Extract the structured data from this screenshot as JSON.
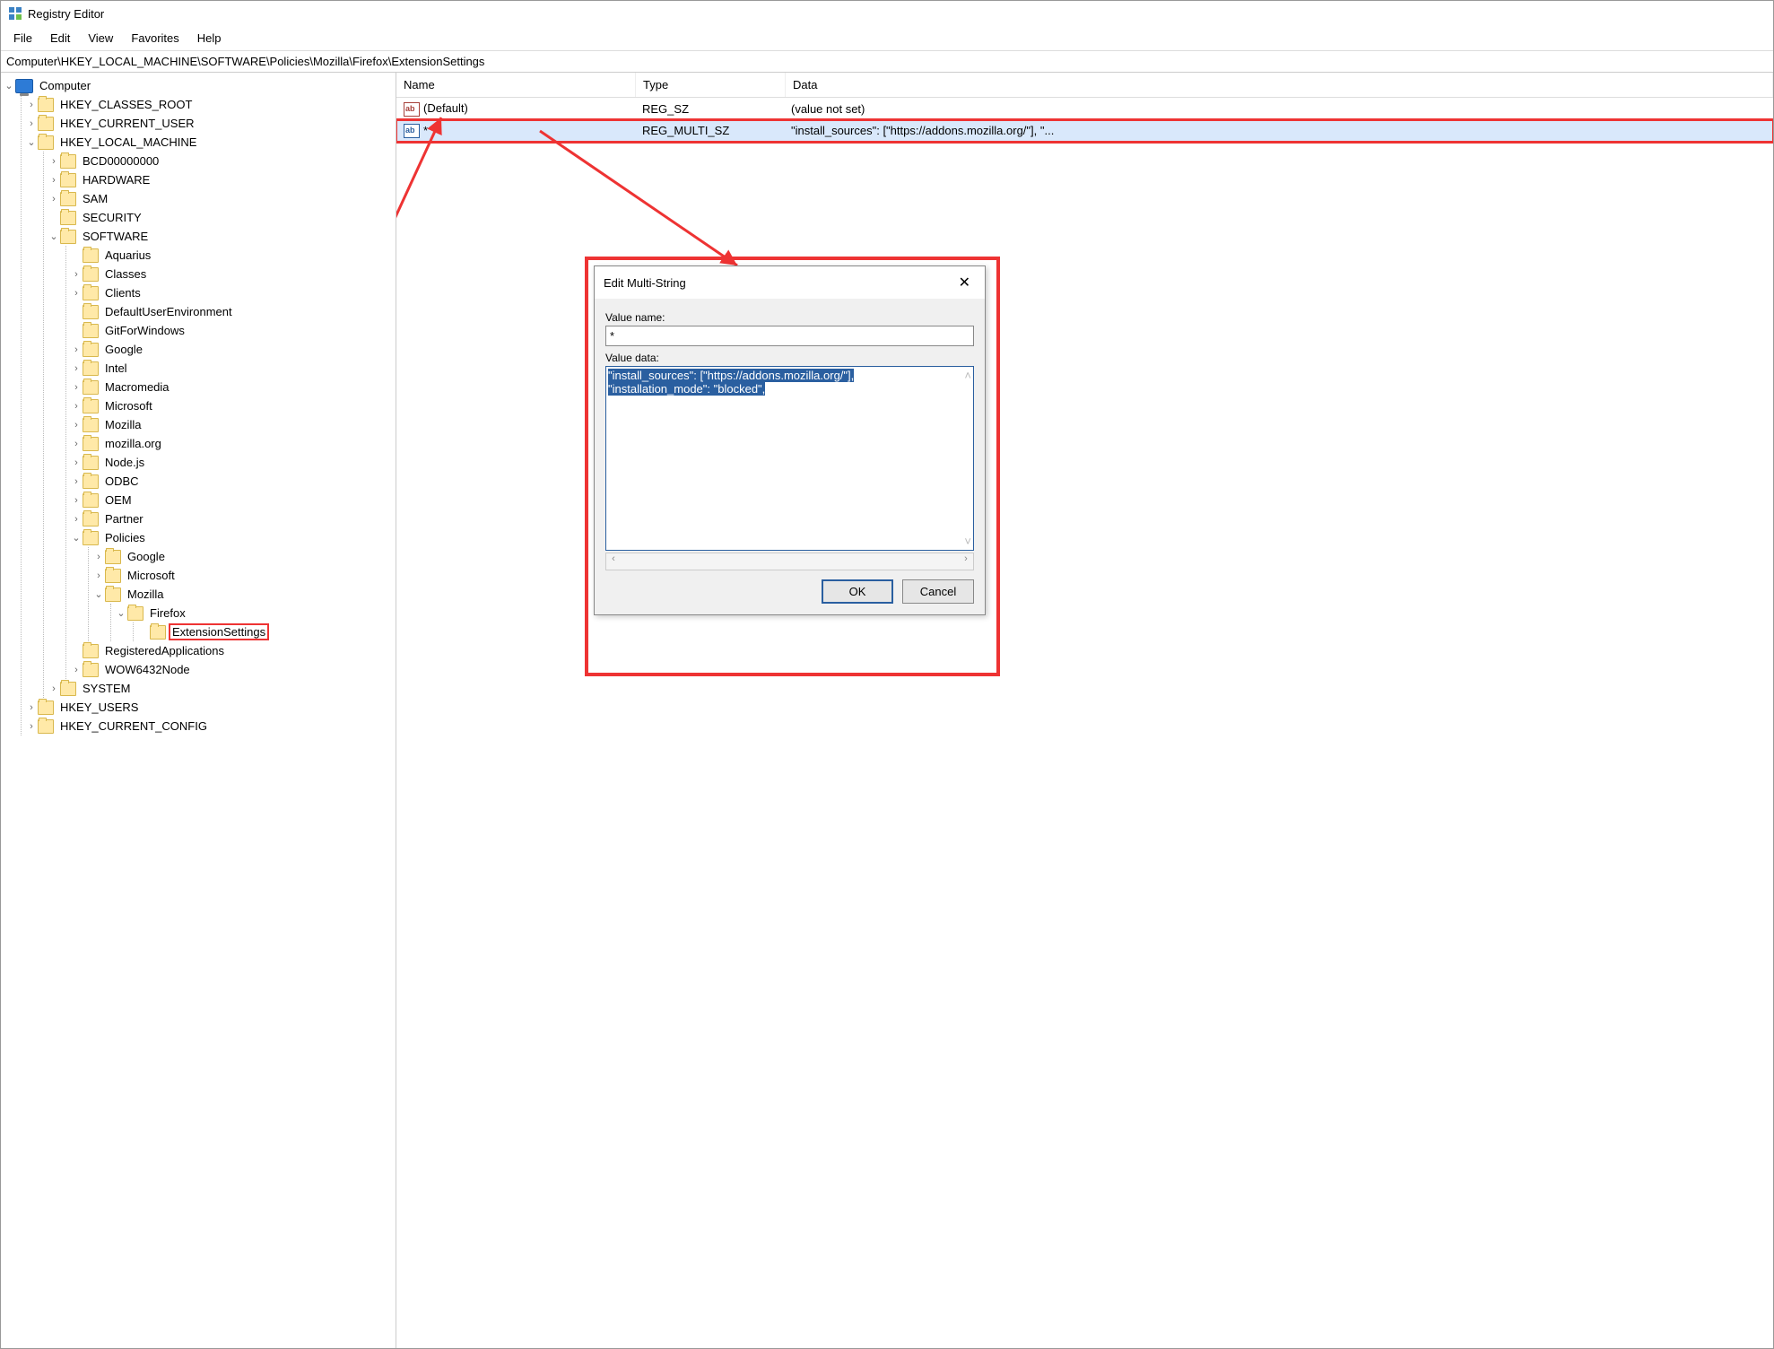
{
  "title": "Registry Editor",
  "menubar": [
    "File",
    "Edit",
    "View",
    "Favorites",
    "Help"
  ],
  "address": "Computer\\HKEY_LOCAL_MACHINE\\SOFTWARE\\Policies\\Mozilla\\Firefox\\ExtensionSettings",
  "tree": {
    "root": "Computer",
    "hives": [
      {
        "name": "HKEY_CLASSES_ROOT",
        "expand": ">"
      },
      {
        "name": "HKEY_CURRENT_USER",
        "expand": ">"
      },
      {
        "name": "HKEY_LOCAL_MACHINE",
        "expand": "v",
        "children": [
          {
            "name": "BCD00000000",
            "expand": ">"
          },
          {
            "name": "HARDWARE",
            "expand": ">"
          },
          {
            "name": "SAM",
            "expand": ">"
          },
          {
            "name": "SECURITY",
            "expand": ""
          },
          {
            "name": "SOFTWARE",
            "expand": "v",
            "children": [
              {
                "name": "Aquarius",
                "expand": ""
              },
              {
                "name": "Classes",
                "expand": ">"
              },
              {
                "name": "Clients",
                "expand": ">"
              },
              {
                "name": "DefaultUserEnvironment",
                "expand": ""
              },
              {
                "name": "GitForWindows",
                "expand": ""
              },
              {
                "name": "Google",
                "expand": ">"
              },
              {
                "name": "Intel",
                "expand": ">"
              },
              {
                "name": "Macromedia",
                "expand": ">"
              },
              {
                "name": "Microsoft",
                "expand": ">"
              },
              {
                "name": "Mozilla",
                "expand": ">"
              },
              {
                "name": "mozilla.org",
                "expand": ">"
              },
              {
                "name": "Node.js",
                "expand": ">"
              },
              {
                "name": "ODBC",
                "expand": ">"
              },
              {
                "name": "OEM",
                "expand": ">"
              },
              {
                "name": "Partner",
                "expand": ">"
              },
              {
                "name": "Policies",
                "expand": "v",
                "children": [
                  {
                    "name": "Google",
                    "expand": ">"
                  },
                  {
                    "name": "Microsoft",
                    "expand": ">"
                  },
                  {
                    "name": "Mozilla",
                    "expand": "v",
                    "children": [
                      {
                        "name": "Firefox",
                        "expand": "v",
                        "children": [
                          {
                            "name": "ExtensionSettings",
                            "expand": "",
                            "selected": true
                          }
                        ]
                      }
                    ]
                  }
                ]
              },
              {
                "name": "RegisteredApplications",
                "expand": ""
              },
              {
                "name": "WOW6432Node",
                "expand": ">"
              }
            ]
          },
          {
            "name": "SYSTEM",
            "expand": ">"
          }
        ]
      },
      {
        "name": "HKEY_USERS",
        "expand": ">"
      },
      {
        "name": "HKEY_CURRENT_CONFIG",
        "expand": ">"
      }
    ]
  },
  "list": {
    "headers": {
      "name": "Name",
      "type": "Type",
      "data": "Data"
    },
    "rows": [
      {
        "icon": "sz",
        "name": "(Default)",
        "type": "REG_SZ",
        "data": "(value not set)",
        "highlight": false
      },
      {
        "icon": "multi",
        "name": "*",
        "type": "REG_MULTI_SZ",
        "data": "\"install_sources\": [\"https://addons.mozilla.org/\"], \"...",
        "highlight": true
      }
    ]
  },
  "dialog": {
    "title": "Edit Multi-String",
    "value_name_label": "Value name:",
    "value_name": "*",
    "value_data_label": "Value data:",
    "value_data_lines": [
      "\"install_sources\": [\"https://addons.mozilla.org/\"],",
      "\"installation_mode\": \"blocked\","
    ],
    "ok": "OK",
    "cancel": "Cancel"
  }
}
